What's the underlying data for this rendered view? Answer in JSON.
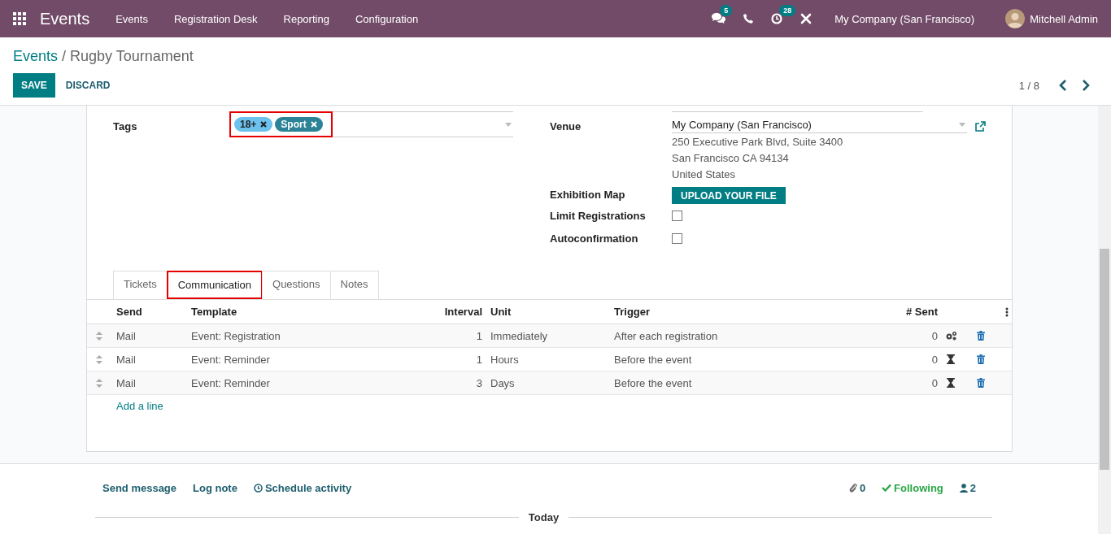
{
  "navbar": {
    "app_name": "Events",
    "menu": [
      "Events",
      "Registration Desk",
      "Reporting",
      "Configuration"
    ],
    "messages_badge": "5",
    "activities_badge": "28",
    "company": "My Company (San Francisco)",
    "user": "Mitchell Admin"
  },
  "breadcrumb": {
    "parent": "Events",
    "separator": "/",
    "current": "Rugby Tournament"
  },
  "actions": [
    {
      "label": "SAVE",
      "kind": "primary"
    },
    {
      "label": "DISCARD",
      "kind": "link"
    }
  ],
  "pager": {
    "value": "1 / 8"
  },
  "form": {
    "tags": {
      "label": "Tags",
      "highlighted": true,
      "items": [
        {
          "label": "18+",
          "color": "#6cc1ed"
        },
        {
          "label": "Sport",
          "color": "#2c8397"
        }
      ]
    },
    "venue": {
      "label": "Venue",
      "value": "My Company (San Francisco)",
      "address": [
        "250 Executive Park Blvd, Suite 3400",
        "San Francisco CA 94134",
        "United States"
      ]
    },
    "exhibition_map": {
      "label": "Exhibition Map",
      "button": "UPLOAD YOUR FILE"
    },
    "checkboxes": [
      {
        "label": "Limit Registrations",
        "checked": false
      },
      {
        "label": "Autoconfirmation",
        "checked": false
      }
    ]
  },
  "tabs": [
    {
      "label": "Tickets",
      "selected": false,
      "highlighted": false
    },
    {
      "label": "Communication",
      "selected": true,
      "highlighted": true
    },
    {
      "label": "Questions",
      "selected": false,
      "highlighted": false
    },
    {
      "label": "Notes",
      "selected": false,
      "highlighted": false
    }
  ],
  "table": {
    "columns": [
      "Send",
      "Template",
      "Interval",
      "Unit",
      "Trigger",
      "# Sent"
    ],
    "rows": [
      {
        "send": "Mail",
        "template": "Event: Registration",
        "interval": "1",
        "unit": "Immediately",
        "trigger": "After each registration",
        "sent": "0",
        "kind": "gears"
      },
      {
        "send": "Mail",
        "template": "Event: Reminder",
        "interval": "1",
        "unit": "Hours",
        "trigger": "Before the event",
        "sent": "0",
        "kind": "hourglass"
      },
      {
        "send": "Mail",
        "template": "Event: Reminder",
        "interval": "3",
        "unit": "Days",
        "trigger": "Before the event",
        "sent": "0",
        "kind": "hourglass"
      }
    ],
    "add_line": "Add a line"
  },
  "chatter": {
    "send_message": "Send message",
    "log_note": "Log note",
    "schedule_activity": "Schedule activity",
    "attachments": "0",
    "follow": "Following",
    "followers": "2",
    "divider": "Today"
  }
}
